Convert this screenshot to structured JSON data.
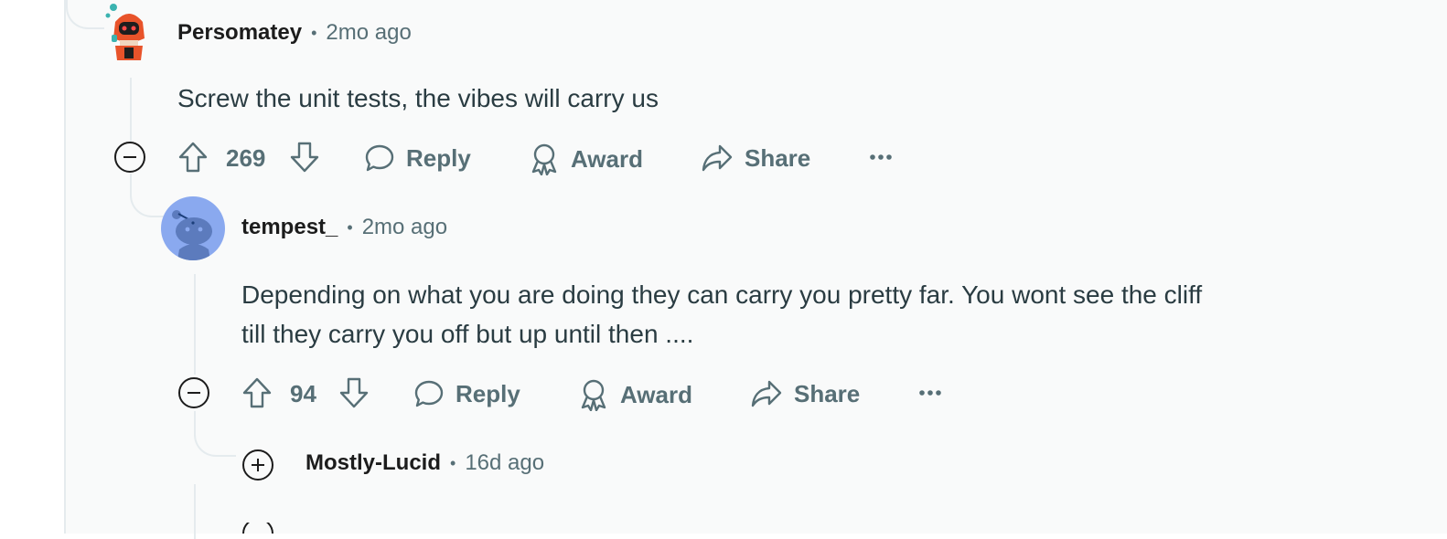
{
  "comments": [
    {
      "username": "Persomatey",
      "separator": "•",
      "time": "2mo ago",
      "body": "Screw the unit tests, the vibes will carry us",
      "votes": "269",
      "actions": {
        "reply": "Reply",
        "award": "Award",
        "share": "Share"
      },
      "avatar": "robot-avatar-icon"
    },
    {
      "username": "tempest_",
      "separator": "•",
      "time": "2mo ago",
      "body_line1": "Depending on what you are doing they can carry you pretty far. You wont see the cliff",
      "body_line2": "till they carry you off but up until then ....",
      "votes": "94",
      "actions": {
        "reply": "Reply",
        "award": "Award",
        "share": "Share"
      },
      "avatar": "default-snoo-avatar-icon"
    },
    {
      "username": "Mostly-Lucid",
      "separator": "•",
      "time": "16d ago",
      "collapsed": true
    }
  ],
  "colors": {
    "background": "#f9fafa",
    "thread_line": "#e5ebee",
    "meta_text": "#576f76",
    "body_text": "#2a3c42",
    "avatar_blue": "#8aa9ef"
  }
}
